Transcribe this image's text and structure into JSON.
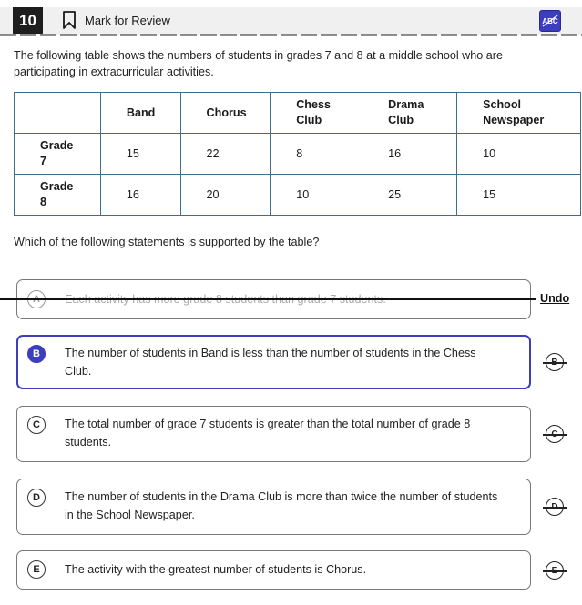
{
  "header": {
    "question_number": "10",
    "mark_label": "Mark for Review",
    "abc_label": "ABC"
  },
  "prompt": "The following table shows the numbers of students in grades 7 and 8 at a middle school who are participating in extracurricular activities.",
  "table": {
    "columns": [
      "",
      "Band",
      "Chorus",
      "Chess Club",
      "Drama Club",
      "School Newspaper"
    ],
    "rows": [
      {
        "label": "Grade 7",
        "values": [
          "15",
          "22",
          "8",
          "16",
          "10"
        ]
      },
      {
        "label": "Grade 8",
        "values": [
          "16",
          "20",
          "10",
          "25",
          "15"
        ]
      }
    ]
  },
  "question": "Which of the following statements is supported by the table?",
  "options": [
    {
      "letter": "A",
      "text": "Each activity has more grade 8 students than grade 7 students.",
      "state": "crossed"
    },
    {
      "letter": "B",
      "text": "The number of students in Band is less than the number of students in the Chess Club.",
      "state": "selected"
    },
    {
      "letter": "C",
      "text": "The total number of grade 7 students is greater than the total number of grade 8 students.",
      "state": "normal"
    },
    {
      "letter": "D",
      "text": "The number of students in the Drama Club is more than twice the number of students in the School Newspaper.",
      "state": "normal"
    },
    {
      "letter": "E",
      "text": "The activity with the greatest number of students is Chorus.",
      "state": "normal"
    }
  ],
  "undo_label": "Undo",
  "colors": {
    "accent": "#3d3dbf",
    "table_border": "#3c6e8c"
  }
}
